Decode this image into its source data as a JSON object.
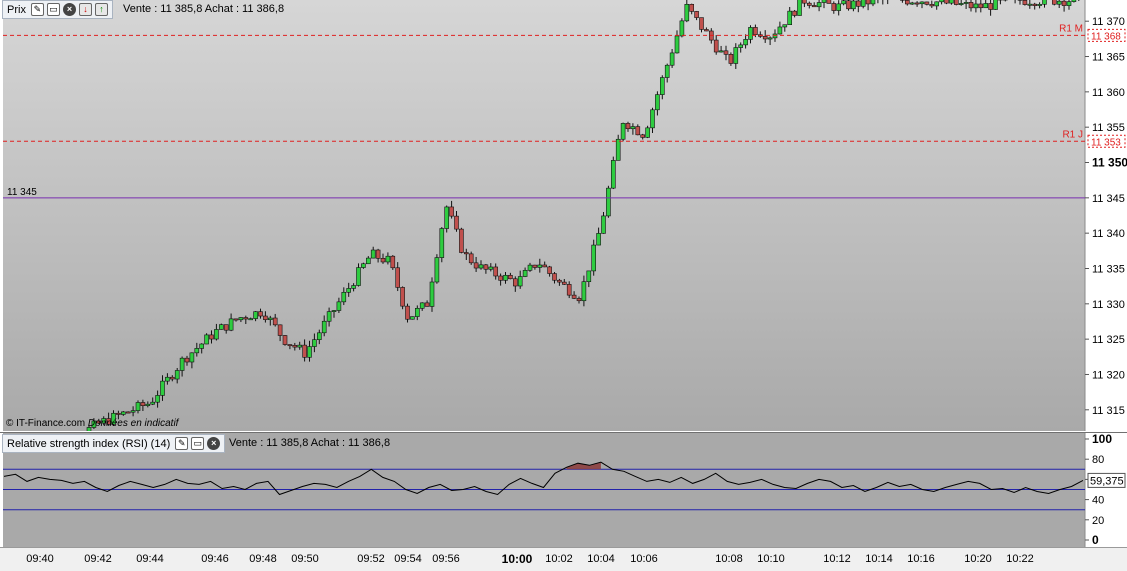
{
  "price_panel": {
    "title": "Prix",
    "quote_text": "Vente : 11 385,8 Achat : 11 386,8",
    "credit": "© IT-Finance.com",
    "credit_note": "Données en indicatif",
    "reference_line": {
      "value": 11345,
      "label": "11 345",
      "color": "#7a2fb0"
    },
    "pivot_lines": [
      {
        "name": "R1 M",
        "value": 11368,
        "label": "11 368",
        "color": "#e02020"
      },
      {
        "name": "R1 J",
        "value": 11353,
        "label": "11 353",
        "color": "#e02020"
      }
    ]
  },
  "rsi_panel": {
    "title": "Relative strength index (RSI) (14)",
    "quote_text": "Vente : 11 385,8 Achat : 11 386,8",
    "current_label": "59,375",
    "levels": [
      70,
      50,
      30
    ]
  },
  "icons": [
    "wrench-icon",
    "window-icon",
    "close-icon",
    "down-arrow-icon",
    "up-arrow-icon"
  ],
  "colors": {
    "up_candle": "#2ecc40",
    "down_candle": "#c0504d",
    "pivot": "#e02020",
    "rsi_line": "#000000",
    "overbought_fill": "#8b3a3a",
    "rsi_bands": "#2222aa"
  },
  "chart_data": [
    {
      "type": "candlestick",
      "title": "Prix",
      "ylim": [
        11312,
        11373
      ],
      "y_ticks": [
        "11 315",
        "11 320",
        "11 325",
        "11 330",
        "11 335",
        "11 340",
        "11 345",
        "11 350",
        "11 355",
        "11 360",
        "11 365",
        "11 370"
      ],
      "y_tick_values": [
        11315,
        11320,
        11325,
        11330,
        11335,
        11340,
        11345,
        11350,
        11355,
        11360,
        11365,
        11370
      ],
      "x_ticks": [
        "09:40",
        "09:42",
        "09:44",
        "09:46",
        "09:48",
        "09:50",
        "09:52",
        "09:54",
        "09:56",
        "10:00",
        "10:02",
        "10:04",
        "10:06",
        "10:08",
        "10:10",
        "10:12",
        "10:14",
        "10:16",
        "10:20",
        "10:22"
      ],
      "series": [
        {
          "time": "09:40",
          "close": 11308
        },
        {
          "time": "09:42",
          "close": 11313
        },
        {
          "time": "09:44",
          "close": 11316
        },
        {
          "time": "09:45",
          "close": 11322
        },
        {
          "time": "09:46",
          "close": 11326
        },
        {
          "time": "09:47",
          "close": 11328
        },
        {
          "time": "09:48",
          "close": 11329
        },
        {
          "time": "09:49",
          "close": 11325
        },
        {
          "time": "09:50",
          "close": 11323
        },
        {
          "time": "09:51",
          "close": 11330
        },
        {
          "time": "09:52",
          "close": 11337
        },
        {
          "time": "09:53",
          "close": 11336
        },
        {
          "time": "09:54",
          "close": 11328
        },
        {
          "time": "09:55",
          "close": 11330
        },
        {
          "time": "09:56",
          "close": 11344
        },
        {
          "time": "09:57",
          "close": 11337
        },
        {
          "time": "09:58",
          "close": 11335
        },
        {
          "time": "10:00",
          "close": 11333
        },
        {
          "time": "10:01",
          "close": 11336
        },
        {
          "time": "10:02",
          "close": 11333
        },
        {
          "time": "10:03",
          "close": 11331
        },
        {
          "time": "10:04",
          "close": 11341
        },
        {
          "time": "10:05",
          "close": 11356
        },
        {
          "time": "10:06",
          "close": 11354
        },
        {
          "time": "10:07",
          "close": 11372
        },
        {
          "time": "10:08",
          "close": 11364
        },
        {
          "time": "10:09",
          "close": 11369
        },
        {
          "time": "10:10",
          "close": 11368
        },
        {
          "time": "10:11",
          "close": 11373
        },
        {
          "time": "10:12",
          "close": 11372
        },
        {
          "time": "10:14",
          "close": 11373
        },
        {
          "time": "10:16",
          "close": 11373
        },
        {
          "time": "10:20",
          "close": 11372
        },
        {
          "time": "10:22",
          "close": 11373
        },
        {
          "time": "10:23",
          "close": 11373
        }
      ]
    },
    {
      "type": "line",
      "title": "Relative strength index (RSI) (14)",
      "ylim": [
        0,
        100
      ],
      "y_ticks": [
        "100",
        "80",
        "60",
        "40",
        "20",
        "0"
      ],
      "y_tick_values": [
        100,
        80,
        60,
        40,
        20,
        0
      ],
      "series": [
        {
          "values": [
            63,
            65,
            58,
            62,
            60,
            59,
            56,
            58,
            52,
            48,
            54,
            58,
            55,
            52,
            55,
            60,
            56,
            55,
            58,
            51,
            53,
            50,
            56,
            58,
            45,
            49,
            53,
            56,
            55,
            52,
            58,
            63,
            70,
            62,
            58,
            50,
            46,
            52,
            55,
            49,
            50,
            53,
            48,
            45,
            55,
            61,
            56,
            52,
            66,
            72,
            76,
            74,
            77,
            70,
            68,
            63,
            58,
            60,
            57,
            62,
            56,
            60,
            66,
            58,
            55,
            57,
            60,
            55,
            52,
            51,
            56,
            60,
            58,
            52,
            54,
            48,
            52,
            57,
            53,
            55,
            50,
            48,
            52,
            55,
            58,
            56,
            50,
            51,
            47,
            52,
            48,
            46,
            50,
            53,
            59
          ]
        }
      ]
    }
  ]
}
